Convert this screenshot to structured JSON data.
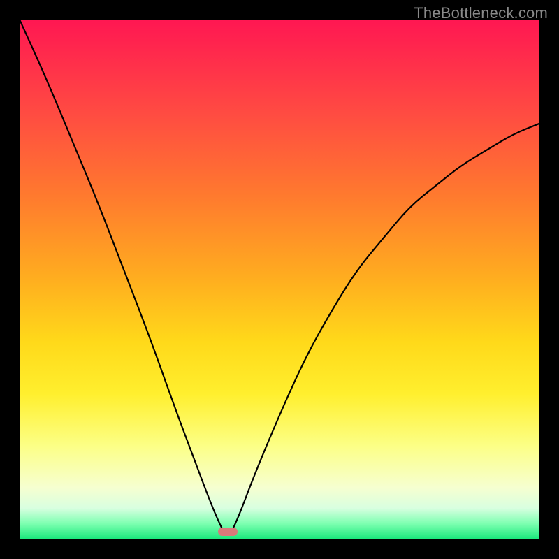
{
  "watermark": "TheBottleneck.com",
  "chart_data": {
    "type": "line",
    "title": "",
    "xlabel": "",
    "ylabel": "",
    "xlim": [
      0,
      100
    ],
    "ylim": [
      0,
      100
    ],
    "min_point": {
      "x": 40,
      "y": 0
    },
    "series": [
      {
        "name": "bottleneck-curve",
        "x": [
          0,
          5,
          10,
          15,
          20,
          25,
          30,
          33,
          36,
          38,
          40,
          42,
          45,
          50,
          55,
          60,
          65,
          70,
          75,
          80,
          85,
          90,
          95,
          100
        ],
        "y": [
          100,
          89,
          77,
          65,
          52,
          39,
          25,
          17,
          9,
          4,
          0,
          4,
          12,
          24,
          35,
          44,
          52,
          58,
          64,
          68,
          72,
          75,
          78,
          80
        ]
      }
    ],
    "marker": {
      "x": 40,
      "y": 1.5,
      "color": "#d97a7a"
    },
    "gradient_stops": [
      {
        "pos": 0,
        "color": "#ff1752"
      },
      {
        "pos": 18,
        "color": "#ff4b42"
      },
      {
        "pos": 34,
        "color": "#ff7a2e"
      },
      {
        "pos": 50,
        "color": "#ffae1f"
      },
      {
        "pos": 62,
        "color": "#ffd91a"
      },
      {
        "pos": 72,
        "color": "#ffef2e"
      },
      {
        "pos": 82,
        "color": "#fcff86"
      },
      {
        "pos": 90,
        "color": "#f6ffd0"
      },
      {
        "pos": 94,
        "color": "#d8ffe0"
      },
      {
        "pos": 97,
        "color": "#7cffb0"
      },
      {
        "pos": 100,
        "color": "#17e87a"
      }
    ]
  }
}
